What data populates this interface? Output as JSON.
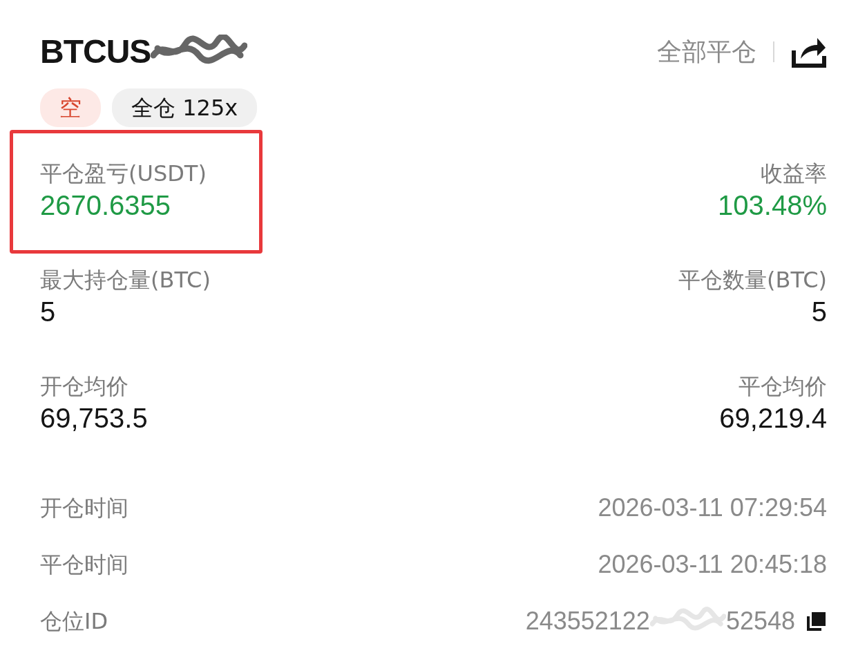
{
  "header": {
    "title": "BTCUS",
    "close_all": "全部平仓"
  },
  "tags": [
    {
      "label": "空",
      "kind": "side"
    },
    {
      "label": "全仓 125x",
      "kind": "margin"
    }
  ],
  "stats": [
    {
      "left": {
        "label": "平仓盈亏(USDT)",
        "value": "2670.6355",
        "kind": "profit",
        "highlighted": true
      },
      "right": {
        "label": "收益率",
        "value": "103.48%",
        "kind": "profit",
        "highlighted": false
      }
    },
    {
      "left": {
        "label": "最大持仓量(BTC)",
        "value": "5",
        "kind": "plain",
        "highlighted": false
      },
      "right": {
        "label": "平仓数量(BTC)",
        "value": "5",
        "kind": "plain",
        "highlighted": false
      }
    },
    {
      "left": {
        "label": "开仓均价",
        "value": "69,753.5",
        "kind": "plain",
        "highlighted": false
      },
      "right": {
        "label": "平仓均价",
        "value": "69,219.4",
        "kind": "plain",
        "highlighted": false
      }
    }
  ],
  "details": [
    {
      "label": "开仓时间",
      "value": "2026-03-11 07:29:54",
      "copyable": false
    },
    {
      "label": "平仓时间",
      "value": "2026-03-11 20:45:18",
      "copyable": false
    },
    {
      "label": "仓位ID",
      "value": "243552122",
      "value_tail": "52548",
      "copyable": true
    }
  ]
}
